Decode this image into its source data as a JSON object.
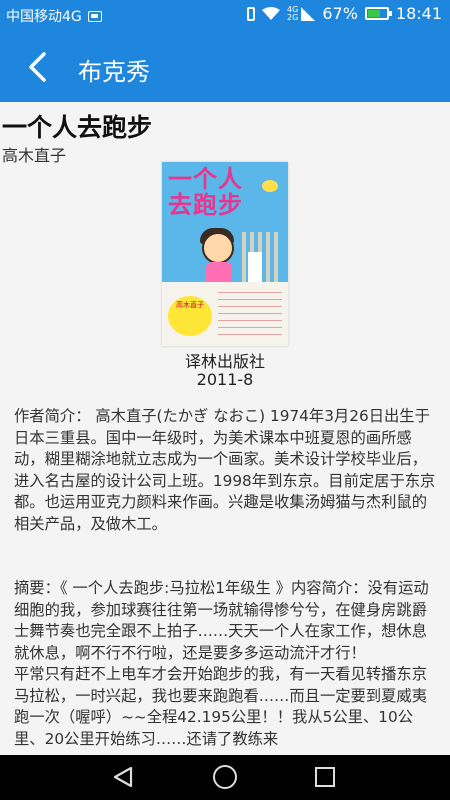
{
  "status_bar": {
    "carrier": "中国移动4G",
    "net_top": "4G",
    "net_bottom": "2G",
    "battery_percent": "67%",
    "battery_level": 0.67,
    "time": "18:41"
  },
  "app_bar": {
    "title": "布克秀",
    "back_icon": "chevron-left-icon"
  },
  "book": {
    "title": "一个人去跑步",
    "author": "高木直子",
    "cover": {
      "title": "一个人去跑步",
      "badge": "高木直子"
    },
    "publisher": "译林出版社",
    "date": "2011-8"
  },
  "intro": {
    "text": "作者简介：  高木直子(たかぎ なおこ)        1974年3月26日出生于日本三重县。国中一年级时，为美术课本中班夏恩的画所感动，糊里糊涂地就立志成为一个画家。美术设计学校毕业后，进入名古屋的设计公司上班。1998年到东京。目前定居于东京都。也运用亚克力颜料来作画。兴趣是收集汤姆猫与杰利鼠的相关产品，及做木工。"
  },
  "summary": {
    "paragraph1": "摘要：《 一个人去跑步:马拉松1年级生 》内容简介：没有运动细胞的我，参加球赛往往第一场就输得惨兮兮，在健身房跳爵士舞节奏也完全跟不上拍子……天天一个人在家工作，想休息就休息，啊不行不行啦，还是要多多运动流汗才行！",
    "paragraph2": "平常只有赶不上电车才会开始跑步的我，有一天看见转播东京马拉松，一时兴起，我也要来跑跑看……而且一定要到夏威夷跑一次（喔呼）~~全程42.195公里！！我从5公里、10公里、20公里开始练习……还请了教练来"
  },
  "nav_bar": {
    "back_icon": "triangle-back-icon",
    "home_icon": "circle-home-icon",
    "recent_icon": "square-recent-icon"
  }
}
